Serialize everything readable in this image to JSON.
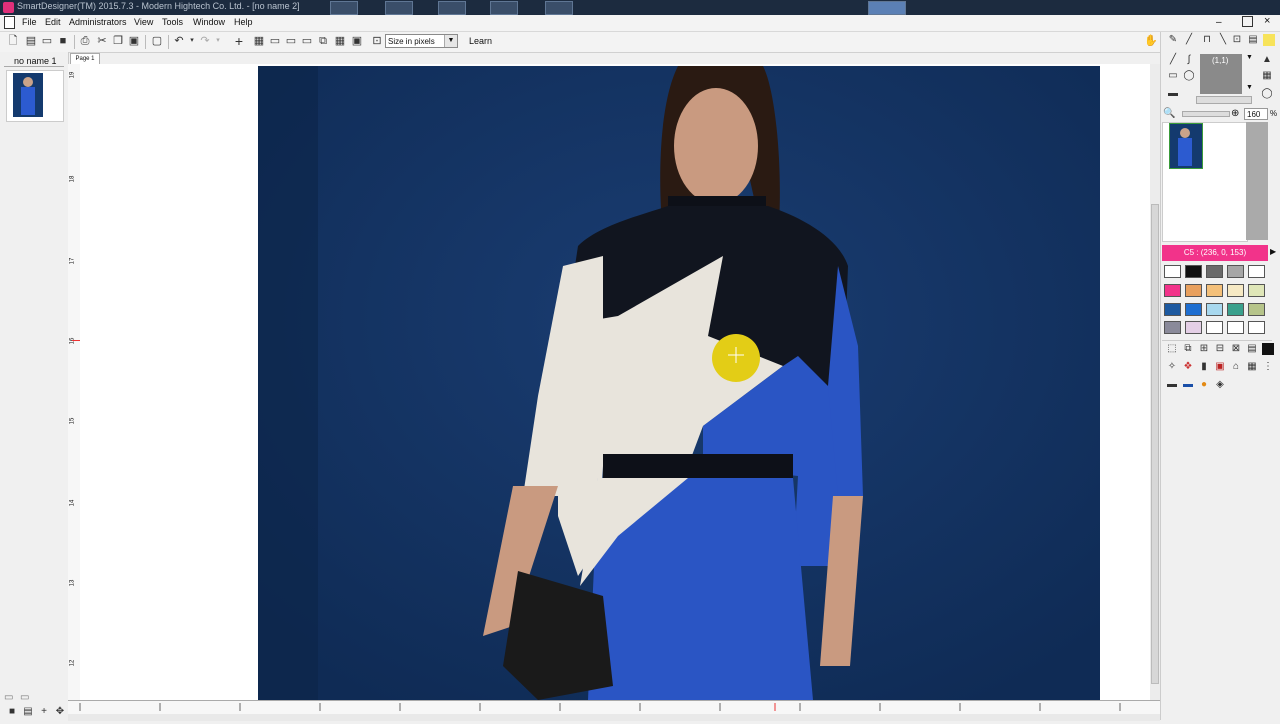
{
  "window": {
    "title": "SmartDesigner(TM) 2015.7.3 - Modern Hightech Co. Ltd. - [no name 2]"
  },
  "menu": [
    "File",
    "Edit",
    "Administrators",
    "View",
    "Tools",
    "Window",
    "Help"
  ],
  "toolbar": {
    "size_select": "Size in pixels",
    "learn_label": "Learn"
  },
  "pages_panel": {
    "doc_tab": "no name 1",
    "page_tab": "Page 1"
  },
  "right_panel": {
    "grid_label": "(1,1)",
    "zoom_value": "160",
    "zoom_unit": "%",
    "color_readout": "C5 : (236, 0, 153)",
    "swatches": [
      "#ffffff",
      "#111111",
      "#6a6a6a",
      "#a6a6a6",
      "#ffffff",
      "#f2338a",
      "#e8a05e",
      "#f4c07a",
      "#f6e9c4",
      "#dfe6b8",
      "#1e5aa0",
      "#1e6ed0",
      "#a8d8ee",
      "#3aa08c",
      "#b6c48a",
      "#8a8a9a",
      "#e4cfe6",
      "#ffffff",
      "#ffffff",
      "#ffffff"
    ],
    "accent_color": "#f2338a"
  },
  "ruler": {
    "left_ticks": [
      "19",
      "18",
      "17",
      "16",
      "15",
      "14",
      "13",
      "12"
    ]
  }
}
